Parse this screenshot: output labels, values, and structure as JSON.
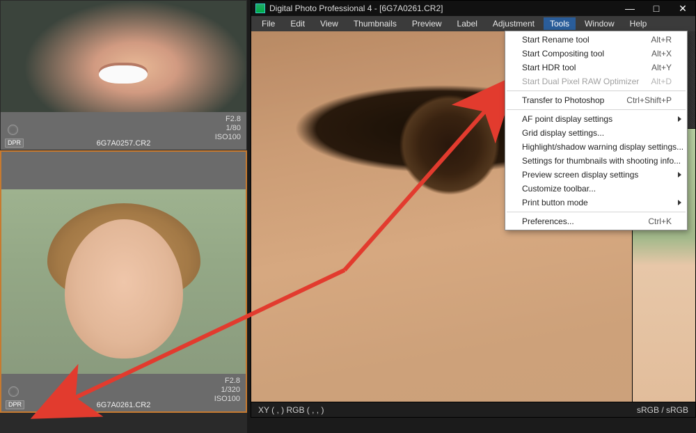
{
  "app": {
    "title": "Digital Photo Professional 4 - [6G7A0261.CR2]"
  },
  "menubar": {
    "items": [
      "File",
      "Edit",
      "View",
      "Thumbnails",
      "Preview",
      "Label",
      "Adjustment",
      "Tools",
      "Window",
      "Help"
    ],
    "active_index": 7
  },
  "tools_menu": {
    "sections": [
      [
        {
          "label": "Start Rename tool",
          "shortcut": "Alt+R",
          "disabled": false
        },
        {
          "label": "Start Compositing tool",
          "shortcut": "Alt+X",
          "disabled": false
        },
        {
          "label": "Start HDR tool",
          "shortcut": "Alt+Y",
          "disabled": false
        },
        {
          "label": "Start Dual Pixel RAW Optimizer",
          "shortcut": "Alt+D",
          "disabled": true
        }
      ],
      [
        {
          "label": "Transfer to Photoshop",
          "shortcut": "Ctrl+Shift+P",
          "disabled": false
        }
      ],
      [
        {
          "label": "AF point display settings",
          "submenu": true
        },
        {
          "label": "Grid display settings..."
        },
        {
          "label": "Highlight/shadow warning display settings..."
        },
        {
          "label": "Settings for thumbnails with shooting info..."
        },
        {
          "label": "Preview screen display settings",
          "submenu": true
        },
        {
          "label": "Customize toolbar..."
        },
        {
          "label": "Print button mode",
          "submenu": true
        }
      ],
      [
        {
          "label": "Preferences...",
          "shortcut": "Ctrl+K"
        }
      ]
    ]
  },
  "sidebar": {
    "thumbs": [
      {
        "filename": "6G7A0257.CR2",
        "aperture": "F2.8",
        "shutter": "1/80",
        "iso": "ISO100",
        "dpr_badge": "DPR",
        "selected": false
      },
      {
        "filename": "6G7A0261.CR2",
        "aperture": "F2.8",
        "shutter": "1/320",
        "iso": "ISO100",
        "dpr_badge": "DPR",
        "selected": true
      }
    ]
  },
  "statusbar": {
    "left": "XY (    ,    ) RGB (    ,    ,    )",
    "right": "sRGB / sRGB"
  },
  "window_controls": {
    "minimize": "—",
    "maximize": "□",
    "close": "✕"
  }
}
